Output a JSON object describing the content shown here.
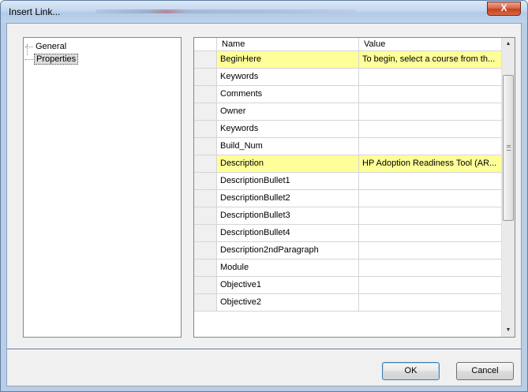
{
  "window": {
    "title": "Insert Link...",
    "close_label": "X"
  },
  "tree": {
    "items": [
      {
        "label": "General",
        "selected": false
      },
      {
        "label": "Properties",
        "selected": true
      }
    ]
  },
  "grid": {
    "columns": [
      "Name",
      "Value"
    ],
    "rows": [
      {
        "name": "BeginHere",
        "value": "To begin, select a course from th...",
        "highlighted": true
      },
      {
        "name": "Keywords",
        "value": "",
        "highlighted": false
      },
      {
        "name": "Comments",
        "value": "",
        "highlighted": false
      },
      {
        "name": "Owner",
        "value": "",
        "highlighted": false
      },
      {
        "name": "Keywords",
        "value": "",
        "highlighted": false
      },
      {
        "name": "Build_Num",
        "value": "",
        "highlighted": false
      },
      {
        "name": "Description",
        "value": "HP Adoption Readiness Tool (AR...",
        "highlighted": true
      },
      {
        "name": "DescriptionBullet1",
        "value": "",
        "highlighted": false
      },
      {
        "name": "DescriptionBullet2",
        "value": "",
        "highlighted": false
      },
      {
        "name": "DescriptionBullet3",
        "value": "",
        "highlighted": false
      },
      {
        "name": "DescriptionBullet4",
        "value": "",
        "highlighted": false
      },
      {
        "name": "Description2ndParagraph",
        "value": "",
        "highlighted": false
      },
      {
        "name": "Module",
        "value": "",
        "highlighted": false
      },
      {
        "name": "Objective1",
        "value": "",
        "highlighted": false
      },
      {
        "name": "Objective2",
        "value": "",
        "highlighted": false
      }
    ]
  },
  "buttons": {
    "ok_label": "OK",
    "cancel_label": "Cancel"
  },
  "colors": {
    "highlight_row": "#ffff99",
    "close_button": "#c7401e"
  }
}
